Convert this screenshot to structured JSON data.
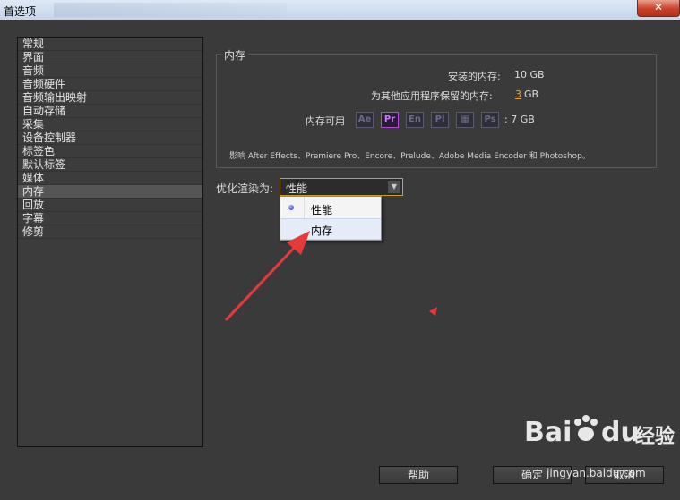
{
  "window": {
    "title": "首选项",
    "close_label": "✕"
  },
  "sidebar": {
    "items": [
      {
        "label": "常规"
      },
      {
        "label": "界面"
      },
      {
        "label": "音频"
      },
      {
        "label": "音频硬件"
      },
      {
        "label": "音频输出映射"
      },
      {
        "label": "自动存储"
      },
      {
        "label": "采集"
      },
      {
        "label": "设备控制器"
      },
      {
        "label": "标签色"
      },
      {
        "label": "默认标签"
      },
      {
        "label": "媒体"
      },
      {
        "label": "内存",
        "selected": true
      },
      {
        "label": "回放"
      },
      {
        "label": "字幕"
      },
      {
        "label": "修剪"
      }
    ]
  },
  "memory": {
    "group_title": "内存",
    "installed_label": "安装的内存:",
    "installed_value": "10 GB",
    "reserved_label": "为其他应用程序保留的内存:",
    "reserved_num": "3",
    "reserved_unit": "GB",
    "available_label": "内存可用",
    "available_value": ": 7 GB",
    "apps": [
      {
        "abbr": "Ae",
        "active": false
      },
      {
        "abbr": "Pr",
        "active": true
      },
      {
        "abbr": "En",
        "active": false
      },
      {
        "abbr": "Pl",
        "active": false
      },
      {
        "abbr": "▦",
        "active": false
      },
      {
        "abbr": "Ps",
        "active": false
      }
    ],
    "note": "影响 After Effects、Premiere Pro、Encore、Prelude、Adobe Media Encoder 和 Photoshop。"
  },
  "render": {
    "label": "优化渲染为:",
    "selected_value": "性能",
    "options": [
      {
        "label": "性能",
        "checked": true
      },
      {
        "label": "内存",
        "checked": false
      }
    ]
  },
  "buttons": {
    "help": "帮助",
    "ok": "确定",
    "cancel": "取消"
  },
  "watermark": {
    "logo": "Bai",
    "logo2": "du",
    "cn": "经验",
    "url": "jingyan.baidu.com"
  },
  "colors": {
    "accent_orange": "#e8a23a",
    "arrow_red": "#e53a3a",
    "premiere_purple": "#c77cff"
  }
}
